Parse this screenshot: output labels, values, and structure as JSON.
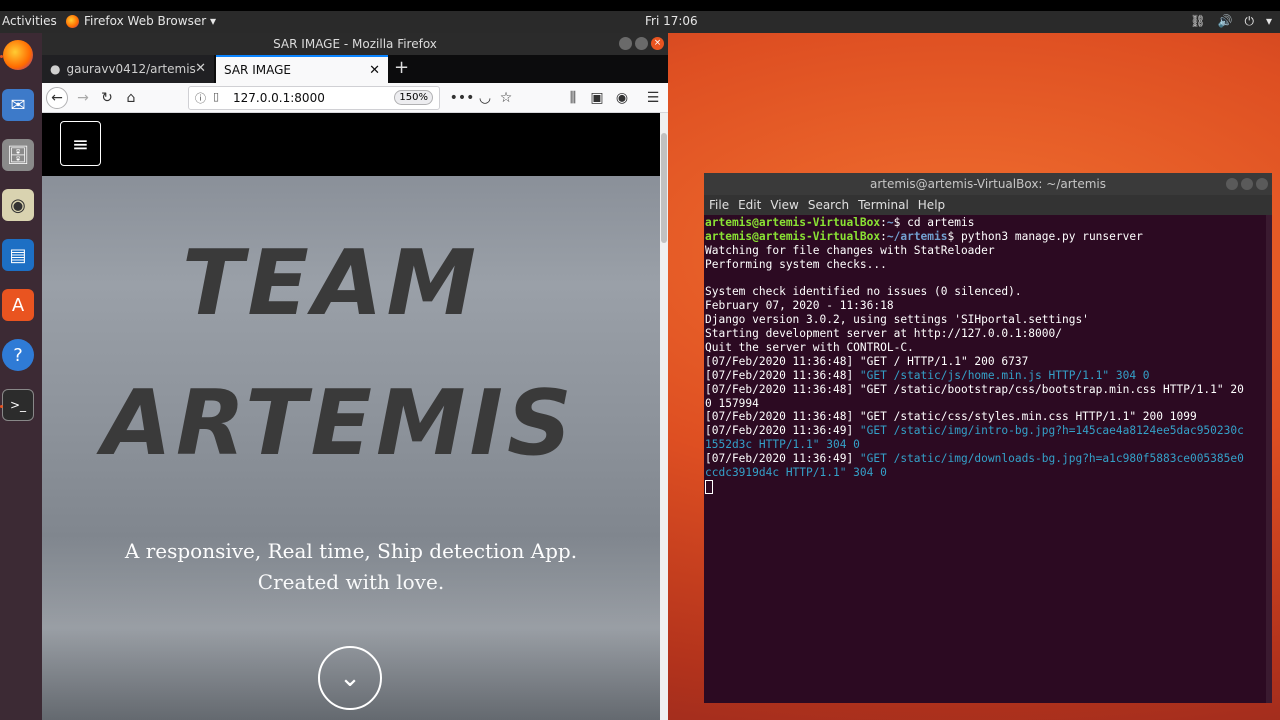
{
  "topbar": {
    "activities": "Activities",
    "app_menu": "Firefox Web Browser ▾",
    "clock": "Fri 17:06"
  },
  "firefox": {
    "window_title": "SAR IMAGE - Mozilla Firefox",
    "tabs": [
      {
        "label": "gauravv0412/artemis"
      },
      {
        "label": "SAR IMAGE"
      }
    ],
    "url": "127.0.0.1:8000",
    "zoom": "150%"
  },
  "page": {
    "title_line1": "TEAM",
    "title_line2": "ARTEMIS",
    "subtitle_line1": "A responsive, Real time,  Ship detection App.",
    "subtitle_line2": "Created with love."
  },
  "terminal": {
    "title": "artemis@artemis-VirtualBox: ~/artemis",
    "menu": [
      "File",
      "Edit",
      "View",
      "Search",
      "Terminal",
      "Help"
    ],
    "prompt1_user": "artemis@artemis-VirtualBox",
    "prompt1_path": "~",
    "prompt1_cmd": "$ cd artemis",
    "prompt2_user": "artemis@artemis-VirtualBox",
    "prompt2_path": "~/artemis",
    "prompt2_cmd": "$ python3 manage.py runserver",
    "l1": "Watching for file changes with StatReloader",
    "l2": "Performing system checks...",
    "l3": "System check identified no issues (0 silenced).",
    "l4": "February 07, 2020 - 11:36:18",
    "l5": "Django version 3.0.2, using settings 'SIHportal.settings'",
    "l6": "Starting development server at http://127.0.0.1:8000/",
    "l7": "Quit the server with CONTROL-C.",
    "l8": "[07/Feb/2020 11:36:48] \"GET / HTTP/1.1\" 200 6737",
    "l9_ts": "[07/Feb/2020 11:36:48] ",
    "l9_req": "\"GET /static/js/home.min.js HTTP/1.1\" 304 0",
    "l10a": "[07/Feb/2020 11:36:48] \"GET /static/bootstrap/css/bootstrap.min.css HTTP/1.1\" 20",
    "l10b": "0 157994",
    "l11": "[07/Feb/2020 11:36:48] \"GET /static/css/styles.min.css HTTP/1.1\" 200 1099",
    "l12_ts": "[07/Feb/2020 11:36:49] ",
    "l12_req": "\"GET /static/img/intro-bg.jpg?h=145cae4a8124ee5dac950230c",
    "l12b": "1552d3c HTTP/1.1\" 304 0",
    "l13_ts": "[07/Feb/2020 11:36:49] ",
    "l13_req": "\"GET /static/img/downloads-bg.jpg?h=a1c980f5883ce005385e0",
    "l13b": "ccdc3919d4c HTTP/1.1\" 304 0"
  }
}
